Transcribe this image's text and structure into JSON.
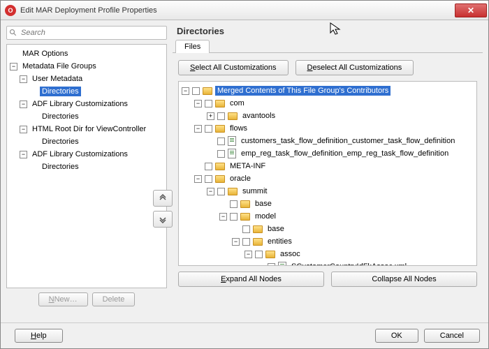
{
  "title": "Edit MAR Deployment Profile Properties",
  "search": {
    "placeholder": "Search"
  },
  "nav": {
    "mar_options": "MAR Options",
    "metadata_groups": "Metadata File Groups",
    "user_metadata": "User Metadata",
    "directories": "Directories",
    "adf_lib_cust": "ADF Library Customizations",
    "html_root": "HTML Root Dir for ViewController",
    "adf_lib_cust2": "ADF Library Customizations"
  },
  "buttons": {
    "new": "New…",
    "delete": "Delete"
  },
  "section": {
    "title": "Directories",
    "tab": "Files"
  },
  "cust": {
    "select_all": "elect All Customizations",
    "deselect_all": "eselect All Customizations"
  },
  "tree": {
    "root": "Merged Contents of This File Group's Contributors",
    "com": "com",
    "avantools": "avantools",
    "flows": "flows",
    "flow1": "customers_task_flow_definition_customer_task_flow_definition",
    "flow2": "emp_reg_task_flow_definition_emp_reg_task_flow_definition",
    "metainf": "META-INF",
    "oracle": "oracle",
    "summit": "summit",
    "base1": "base",
    "model": "model",
    "base2": "base",
    "entities": "entities",
    "assoc": "assoc",
    "xml1": "SCustomerCountryIdFkAssoc.xml"
  },
  "expand": {
    "expand_all": "xpand All Nodes",
    "collapse_all": "Collapse All Nodes"
  },
  "footer": {
    "help": "elp",
    "ok": "OK",
    "cancel": "Cancel"
  }
}
